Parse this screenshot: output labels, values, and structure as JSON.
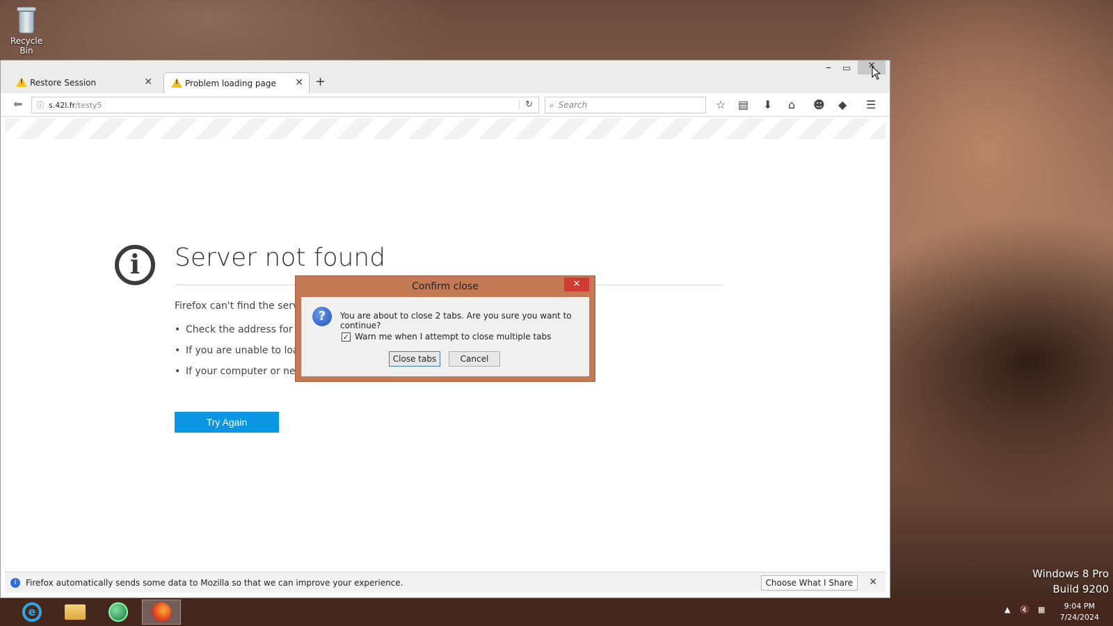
{
  "desktop": {
    "recycle_bin_label": "Recycle Bin"
  },
  "browser": {
    "tabs": [
      {
        "label": "Restore Session",
        "icon": "warning-icon"
      },
      {
        "label": "Problem loading page",
        "icon": "warning-icon"
      }
    ],
    "url": {
      "host": "s.42l.fr",
      "path": "/testy5"
    },
    "search_placeholder": "Search"
  },
  "error_page": {
    "title": "Server not found",
    "description": "Firefox can't find the serve",
    "bullets": [
      "Check the address for ty                                                                                    m",
      "If you are unable to loac",
      "If your computer or netw                                                                     ermitted to access the Web."
    ],
    "try_again_label": "Try Again"
  },
  "notification": {
    "text": "Firefox automatically sends some data to Mozilla so that we can improve your experience.",
    "button_label": "Choose What I Share"
  },
  "dialog": {
    "title": "Confirm close",
    "message": "You are about to close 2 tabs. Are you sure you want to continue?",
    "checkbox_label": "Warn me when I attempt to close multiple tabs",
    "checkbox_checked": true,
    "primary_label": "Close tabs",
    "cancel_label": "Cancel"
  },
  "taskbar": {
    "apps": [
      "internet-explorer-icon",
      "file-explorer-icon",
      "chrome-icon",
      "firefox-icon"
    ],
    "time": "9:04 PM",
    "date": "7/24/2024"
  },
  "watermark": {
    "line1": "Windows 8 Pro",
    "line2": "Build 9200"
  },
  "colors": {
    "try_again": "#0a96e0",
    "dialog_frame": "#c47a55",
    "dialog_close": "#d03c33"
  }
}
